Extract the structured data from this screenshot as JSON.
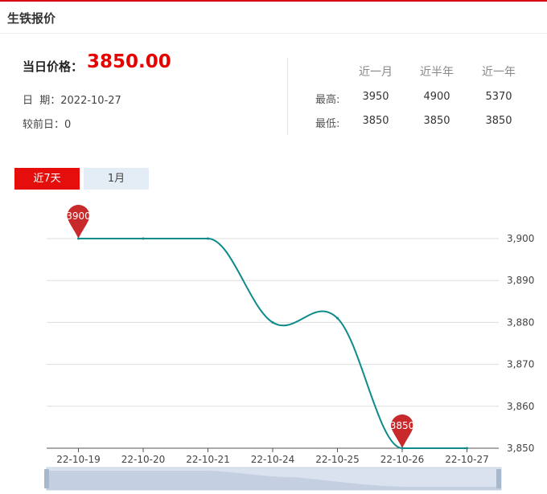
{
  "header": {
    "title": "生铁报价"
  },
  "summary": {
    "price_label": "当日价格：",
    "price": "3850.00",
    "date_text": "日  期：2022-10-27",
    "change_text": "较前日：0"
  },
  "stats": {
    "columns": [
      "近一月",
      "近半年",
      "近一年"
    ],
    "rows": [
      {
        "label": "最高:",
        "values": [
          "3950",
          "4900",
          "5370"
        ]
      },
      {
        "label": "最低:",
        "values": [
          "3850",
          "3850",
          "3850"
        ]
      }
    ]
  },
  "tabs": [
    {
      "label": "近7天",
      "active": true
    },
    {
      "label": "1月",
      "active": false
    }
  ],
  "chart_data": {
    "type": "line",
    "x": [
      "22-10-19",
      "22-10-20",
      "22-10-21",
      "22-10-24",
      "22-10-25",
      "22-10-26",
      "22-10-27"
    ],
    "series": [
      {
        "values": [
          3900,
          3900,
          3900,
          3880,
          3881,
          3850,
          3850
        ],
        "color": "#0e8a8a"
      }
    ],
    "ylim": [
      3850,
      3900
    ],
    "yticks": [
      "3,900",
      "3,890",
      "3,880",
      "3,870",
      "3,860",
      "3,850"
    ],
    "ytick_values": [
      3900,
      3890,
      3880,
      3870,
      3860,
      3850
    ],
    "grid": true,
    "markers": [
      {
        "label": "3900",
        "index": 0,
        "value": 3900
      },
      {
        "label": "3850",
        "index": 5,
        "value": 3850
      }
    ],
    "marker_color": "#c8292b",
    "datazoom": true
  }
}
